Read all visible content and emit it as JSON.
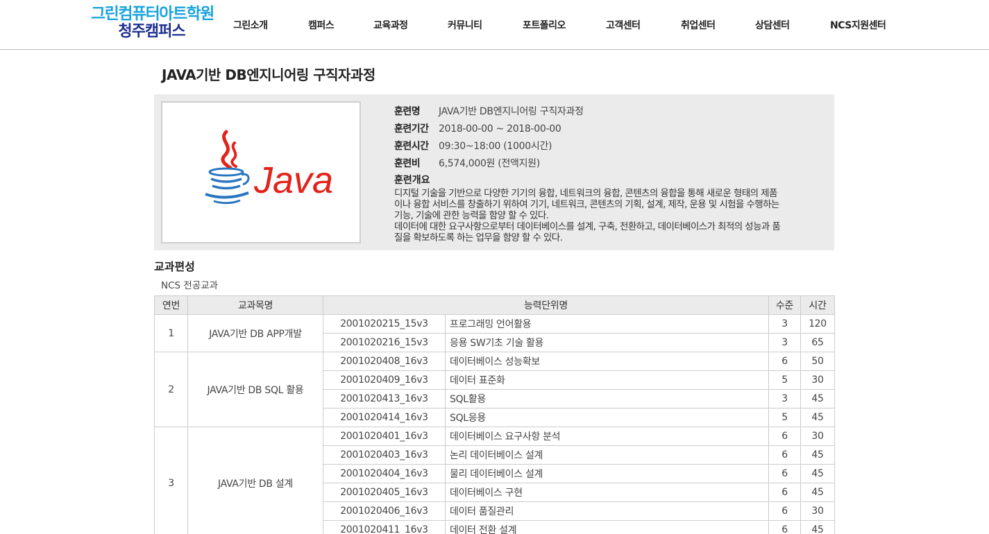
{
  "header": {
    "logo_main": "그린컴퓨터아트학원",
    "logo_sub": "청주캠퍼스",
    "nav": [
      "그린소개",
      "캠퍼스",
      "교육과정",
      "커뮤니티",
      "포트폴리오",
      "고객센터",
      "취업센터",
      "상담센터",
      "NCS지원센터"
    ]
  },
  "course": {
    "title": "JAVA기반 DB엔지니어링 구직자과정",
    "image_text": "Java",
    "info": [
      {
        "label": "훈련명",
        "value": "JAVA기반 DB엔지니어링 구직자과정"
      },
      {
        "label": "훈련기간",
        "value": "2018-00-00 ~ 2018-00-00"
      },
      {
        "label": "훈련시간",
        "value": "09:30~18:00 (1000시간)"
      },
      {
        "label": "훈련비",
        "value": "6,574,000원 (전액지원)"
      }
    ],
    "overview_label": "훈련개요",
    "overview_lines": [
      "디지털 기술을 기반으로 다양한 기기의 융합, 네트워크의 융합, 콘텐츠의 융합을 통해 새로운 형태의 제품",
      "이나 융합 서비스를 창출하기 위하여 기기, 네트워크, 콘텐츠의 기획, 설계, 제작, 운용 및 시험을 수행하는",
      "기능, 기술에 관한 능력을 함양 할 수 있다.",
      "데이터에 대한 요구사항으로부터 데이터베이스를 설계, 구축, 전환하고, 데이터베이스가 최적의 성능과 품",
      "질을 확보하도록 하는 업무을 함양 할 수 있다."
    ]
  },
  "curriculum": {
    "title": "교과편성",
    "subtitle": "NCS 전공교과",
    "columns": {
      "no": "연번",
      "subject": "교과목명",
      "unit": "능력단위명",
      "level": "수준",
      "hours": "시간"
    },
    "groups": [
      {
        "no": "1",
        "subject": "JAVA기반 DB APP개발",
        "rows": [
          {
            "code": "2001020215_15v3",
            "name": "프로그래밍 언어활용",
            "level": "3",
            "hours": "120"
          },
          {
            "code": "2001020216_15v3",
            "name": "응용 SW기초 기술 활용",
            "level": "3",
            "hours": "65"
          }
        ]
      },
      {
        "no": "2",
        "subject": "JAVA기반 DB SQL 활용",
        "rows": [
          {
            "code": "2001020408_16v3",
            "name": "데이터베이스 성능확보",
            "level": "6",
            "hours": "50"
          },
          {
            "code": "2001020409_16v3",
            "name": "데이터 표준화",
            "level": "5",
            "hours": "30"
          },
          {
            "code": "2001020413_16v3",
            "name": "SQL활용",
            "level": "3",
            "hours": "45"
          },
          {
            "code": "2001020414_16v3",
            "name": "SQL응용",
            "level": "5",
            "hours": "45"
          }
        ]
      },
      {
        "no": "3",
        "subject": "JAVA기반 DB 설계",
        "rows": [
          {
            "code": "2001020401_16v3",
            "name": "데이터베이스 요구사항 분석",
            "level": "6",
            "hours": "30"
          },
          {
            "code": "2001020403_16v3",
            "name": "논리 데이터베이스 설계",
            "level": "6",
            "hours": "45"
          },
          {
            "code": "2001020404_16v3",
            "name": "물리 데이터베이스 설계",
            "level": "6",
            "hours": "45"
          },
          {
            "code": "2001020405_16v3",
            "name": "데이터베이스 구현",
            "level": "6",
            "hours": "45"
          },
          {
            "code": "2001020406_16v3",
            "name": "데이터 품질관리",
            "level": "6",
            "hours": "30"
          },
          {
            "code": "2001020411_16v3",
            "name": "데이터 전환 설계",
            "level": "6",
            "hours": "45"
          }
        ]
      }
    ]
  },
  "colors": {
    "logo_main": "#1aa3de",
    "logo_sub": "#1d2f8e",
    "java_red": "#e3231b",
    "java_blue": "#2875c1"
  },
  "icons": {
    "course_image": "java-logo-icon"
  }
}
